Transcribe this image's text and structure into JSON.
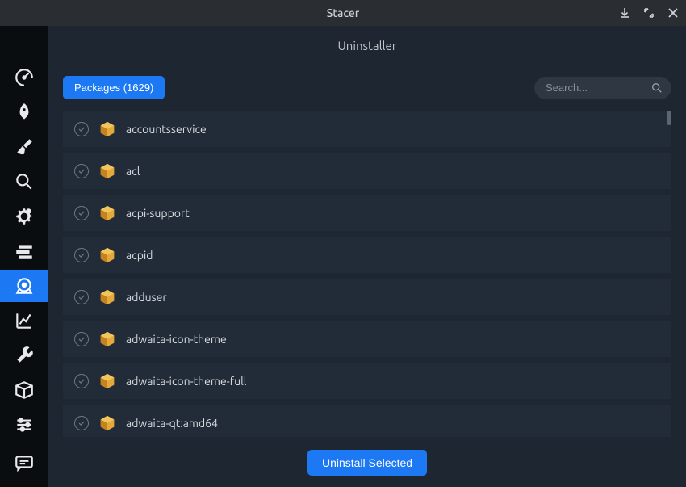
{
  "window": {
    "title": "Stacer"
  },
  "page": {
    "title": "Uninstaller"
  },
  "toolbar": {
    "packages_label": "Packages (1629)",
    "package_count": 1629,
    "uninstall_label": "Uninstall Selected"
  },
  "search": {
    "placeholder": "Search..."
  },
  "sidebar": {
    "items": [
      {
        "name": "dashboard",
        "icon": "speedometer-icon"
      },
      {
        "name": "startup",
        "icon": "rocket-icon"
      },
      {
        "name": "cleaner",
        "icon": "broom-icon"
      },
      {
        "name": "search",
        "icon": "magnifier-icon"
      },
      {
        "name": "services",
        "icon": "gear-icon"
      },
      {
        "name": "processes",
        "icon": "tasks-icon"
      },
      {
        "name": "uninstaller",
        "icon": "disc-icon",
        "active": true
      },
      {
        "name": "resources",
        "icon": "chart-icon"
      },
      {
        "name": "tools",
        "icon": "wrench-icon"
      },
      {
        "name": "packages",
        "icon": "box-icon"
      },
      {
        "name": "settings",
        "icon": "sliders-icon"
      }
    ],
    "footer_item": {
      "name": "feedback",
      "icon": "message-icon"
    }
  },
  "packages": [
    {
      "name": "accountsservice"
    },
    {
      "name": "acl"
    },
    {
      "name": "acpi-support"
    },
    {
      "name": "acpid"
    },
    {
      "name": "adduser"
    },
    {
      "name": "adwaita-icon-theme"
    },
    {
      "name": "adwaita-icon-theme-full"
    },
    {
      "name": "adwaita-qt:amd64"
    }
  ]
}
